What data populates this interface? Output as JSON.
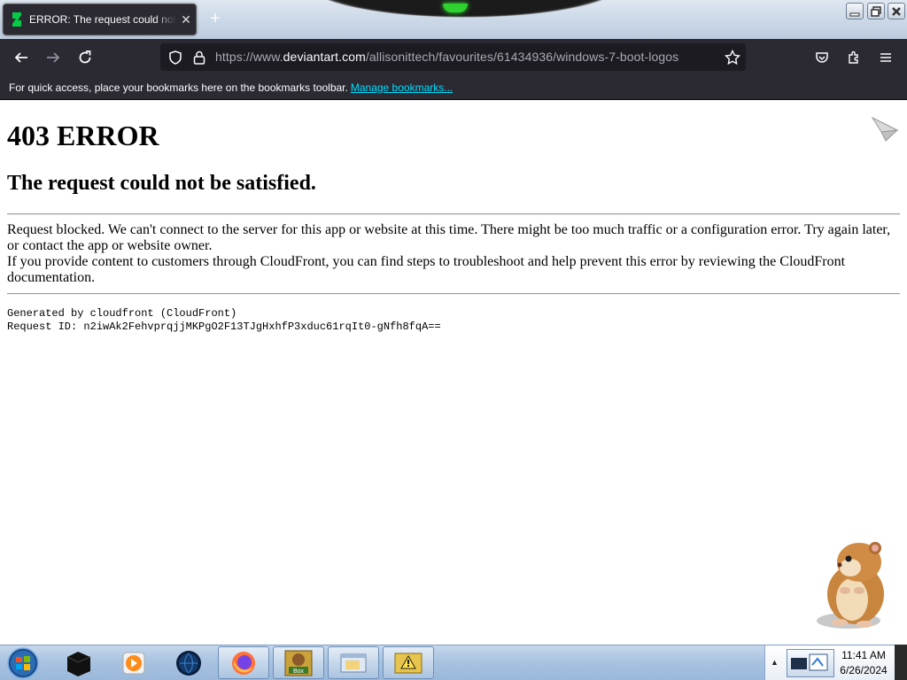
{
  "browser": {
    "tab": {
      "title": "ERROR: The request could not be satisfied",
      "close_glyph": "✕"
    },
    "new_tab_glyph": "+",
    "url": {
      "prefix": "https://www.",
      "host": "deviantart.com",
      "path": "/allisonittech/favourites/61434936/windows-7-boot-logos"
    },
    "bookmarks_bar": {
      "message": "For quick access, place your bookmarks here on the bookmarks toolbar.",
      "link": "Manage bookmarks..."
    },
    "icons": {
      "back": "back-arrow-icon",
      "forward": "forward-arrow-icon",
      "reload": "reload-icon",
      "shield": "tracking-protection-icon",
      "lock": "lock-icon",
      "star": "bookmark-star-icon",
      "pocket": "pocket-icon",
      "extensions": "extensions-icon",
      "menu": "hamburger-menu-icon"
    }
  },
  "page": {
    "heading": "403 ERROR",
    "subheading": "The request could not be satisfied.",
    "paragraph1": "Request blocked. We can't connect to the server for this app or website at this time. There might be too much traffic or a configuration error. Try again later, or contact the app or website owner.",
    "paragraph2": "If you provide content to customers through CloudFront, you can find steps to troubleshoot and help prevent this error by reviewing the CloudFront documentation.",
    "generated_by": "Generated by cloudfront (CloudFront)",
    "request_id": "Request ID: n2iwAk2FehvprqjjMKPgO2F13TJgHxhfP3xduc61rqIt0-gNfh8fqA=="
  },
  "taskbar": {
    "items": [
      {
        "name": "terminal",
        "icon": "black-box-icon"
      },
      {
        "name": "media-player",
        "icon": "media-player-icon"
      },
      {
        "name": "globe",
        "icon": "globe-icon"
      },
      {
        "name": "firefox",
        "icon": "firefox-icon"
      },
      {
        "name": "bonzi-box",
        "icon": "box-app-icon",
        "label": "Box"
      },
      {
        "name": "explorer",
        "icon": "folder-window-icon"
      },
      {
        "name": "warning-app",
        "icon": "warning-app-icon"
      }
    ],
    "clock": {
      "time": "11:41 AM",
      "date": "6/26/2024"
    }
  },
  "colors": {
    "toolbar": "#2b2a33",
    "urlbar": "#1c1b22",
    "link": "#00ddff",
    "taskbar": "#a9c3e0"
  }
}
